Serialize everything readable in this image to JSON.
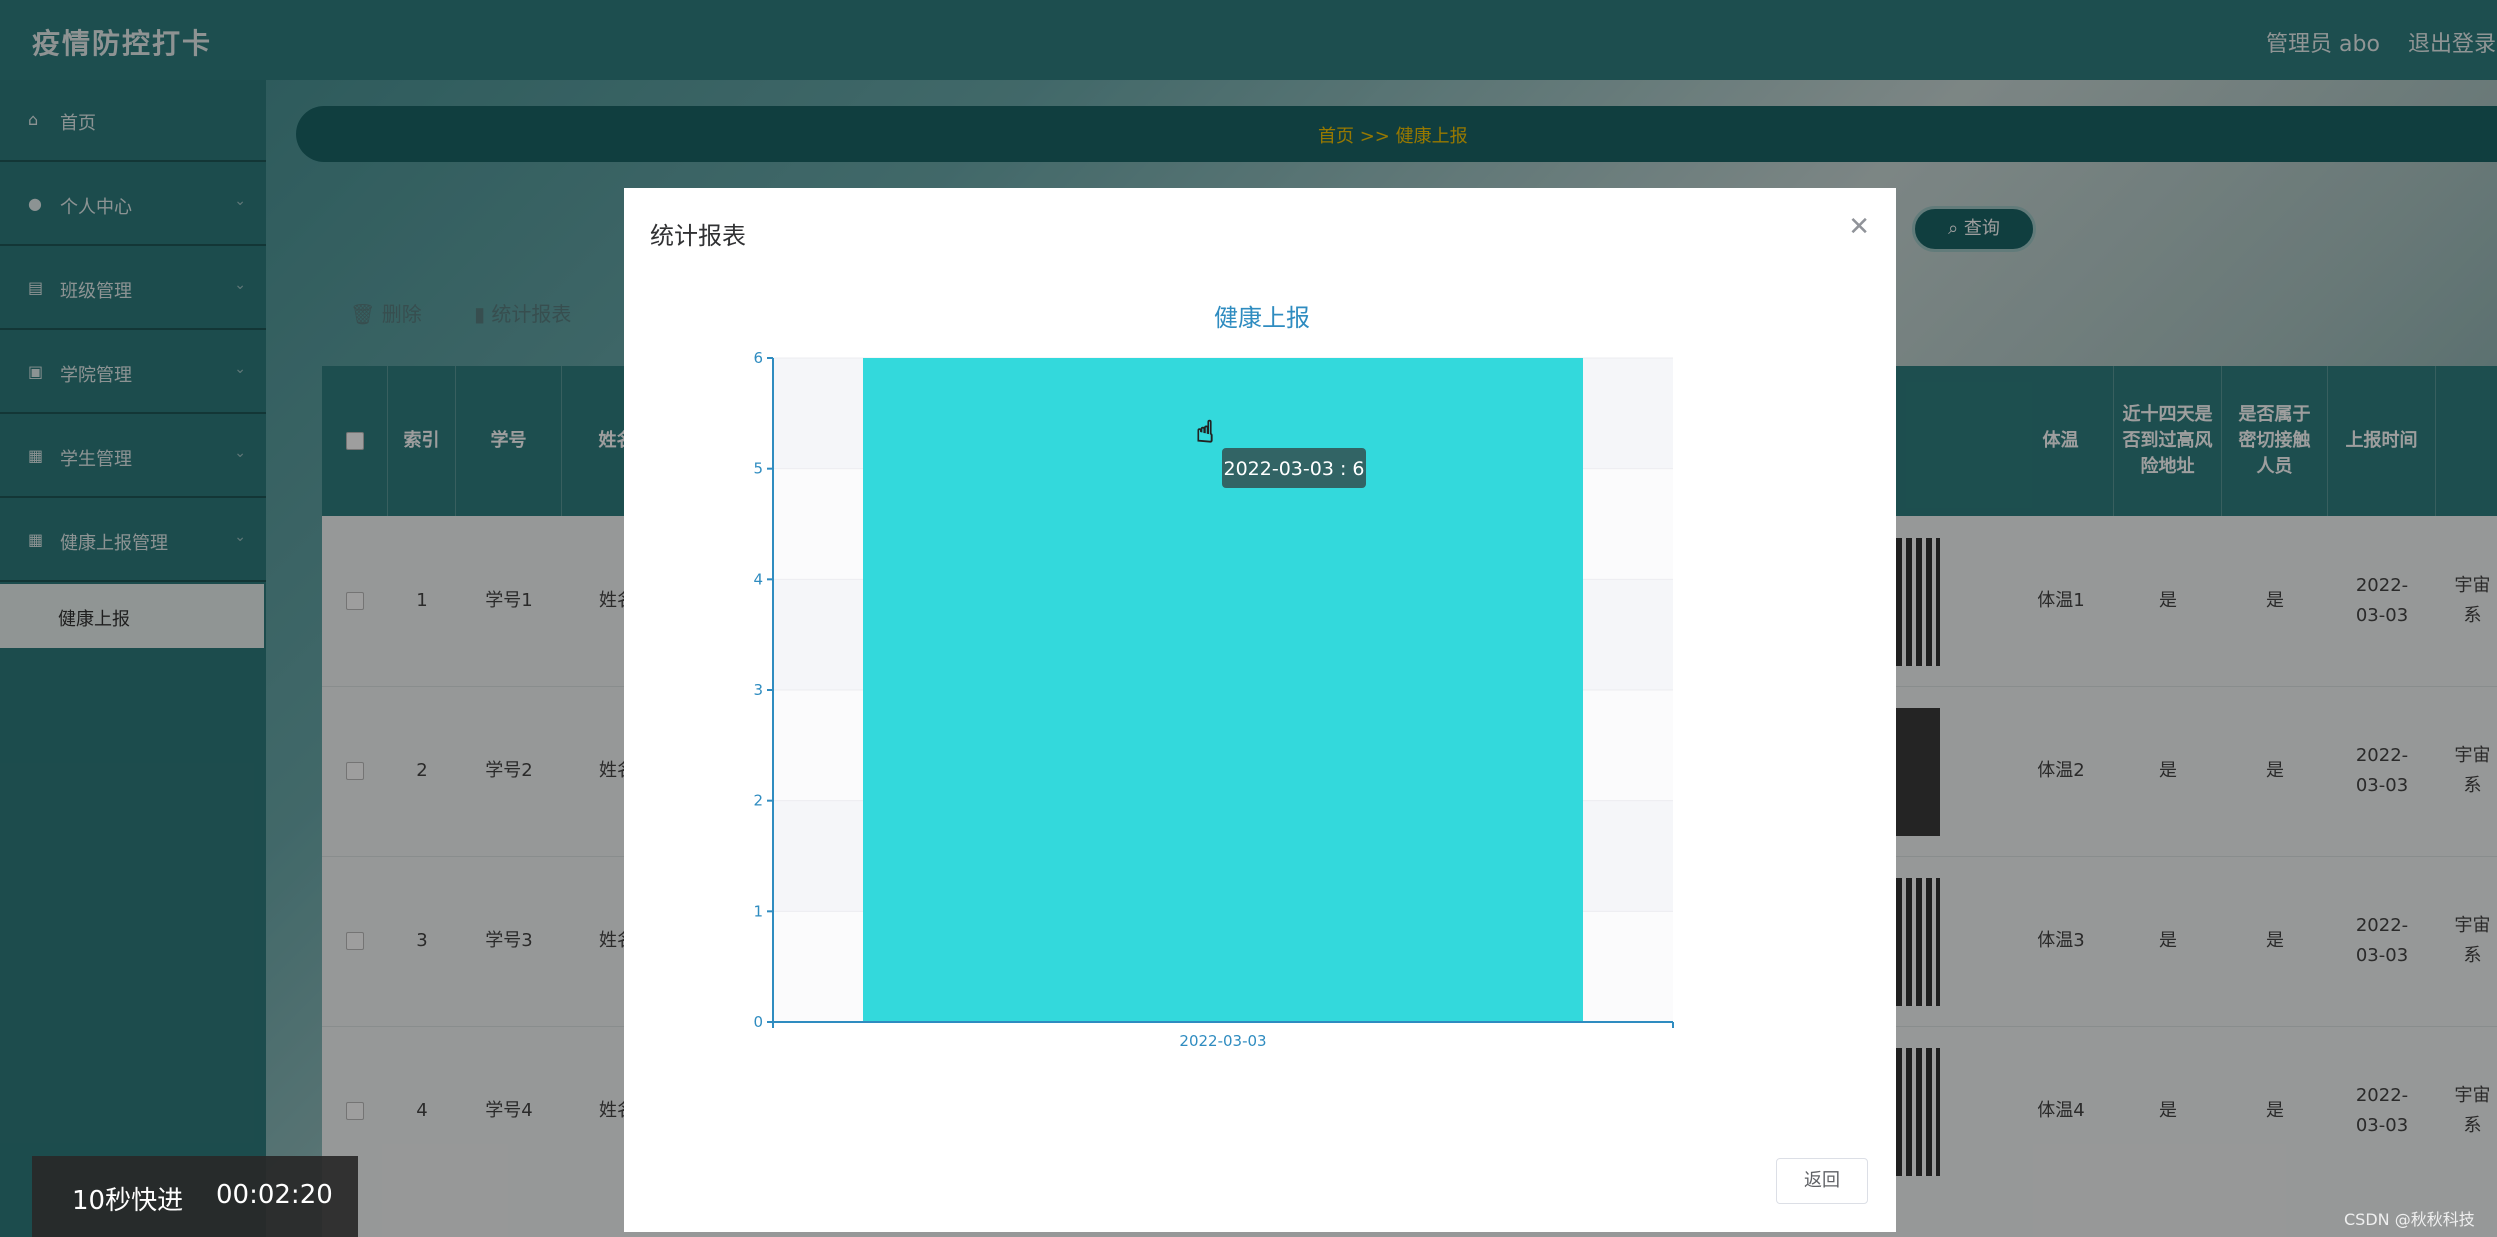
{
  "app": {
    "title": "疫情防控打卡",
    "admin": "管理员 abo",
    "logout": "退出登录"
  },
  "sidebar": {
    "items": [
      {
        "label": "首页",
        "icon": "home-icon"
      },
      {
        "label": "个人中心",
        "icon": "user-icon"
      },
      {
        "label": "班级管理",
        "icon": "clipboard-icon"
      },
      {
        "label": "学院管理",
        "icon": "edit-icon"
      },
      {
        "label": "学生管理",
        "icon": "grid-icon"
      },
      {
        "label": "健康上报管理",
        "icon": "grid-icon"
      }
    ],
    "subitem": "健康上报"
  },
  "breadcrumb": "首页  >>  健康上报",
  "search": {
    "label": "查询"
  },
  "toolbar": {
    "delete": "删除",
    "stats": "统计报表"
  },
  "table": {
    "headers": [
      "索引",
      "学号",
      "姓名",
      "体温",
      "近十四天是否到过高风险地址",
      "是否属于密切接触人员",
      "上报时间"
    ],
    "rows": [
      {
        "index": "1",
        "id": "学号1",
        "name": "姓名",
        "temp": "体温1",
        "risk": "是",
        "contact": "是",
        "time": "2022-03-03",
        "extra": "宇宙系"
      },
      {
        "index": "2",
        "id": "学号2",
        "name": "姓名",
        "temp": "体温2",
        "risk": "是",
        "contact": "是",
        "time": "2022-03-03",
        "extra": "宇宙系"
      },
      {
        "index": "3",
        "id": "学号3",
        "name": "姓名",
        "temp": "体温3",
        "risk": "是",
        "contact": "是",
        "time": "2022-03-03",
        "extra": "宇宙系"
      },
      {
        "index": "4",
        "id": "学号4",
        "name": "姓名",
        "temp": "体温4",
        "risk": "是",
        "contact": "是",
        "time": "2022-03-03",
        "extra": "宇宙系"
      }
    ]
  },
  "dialog": {
    "title": "统计报表",
    "return_label": "返回",
    "tooltip": "2022-03-03 : 6"
  },
  "chart_data": {
    "type": "bar",
    "title": "健康上报",
    "categories": [
      "2022-03-03"
    ],
    "values": [
      6
    ],
    "ylim": [
      0,
      6
    ],
    "yticks": [
      0,
      1,
      2,
      3,
      4,
      5,
      6
    ],
    "bar_color": "#33d9dc",
    "axis_color": "#2f8cc0",
    "grid": true
  },
  "video": {
    "fast_forward": "10秒快进",
    "time": "00:02:20"
  },
  "watermark": "CSDN @秋秋科技",
  "colors": {
    "teal": "#2f7f80",
    "accent_gold": "#f4c200",
    "bar": "#33d9dc"
  }
}
